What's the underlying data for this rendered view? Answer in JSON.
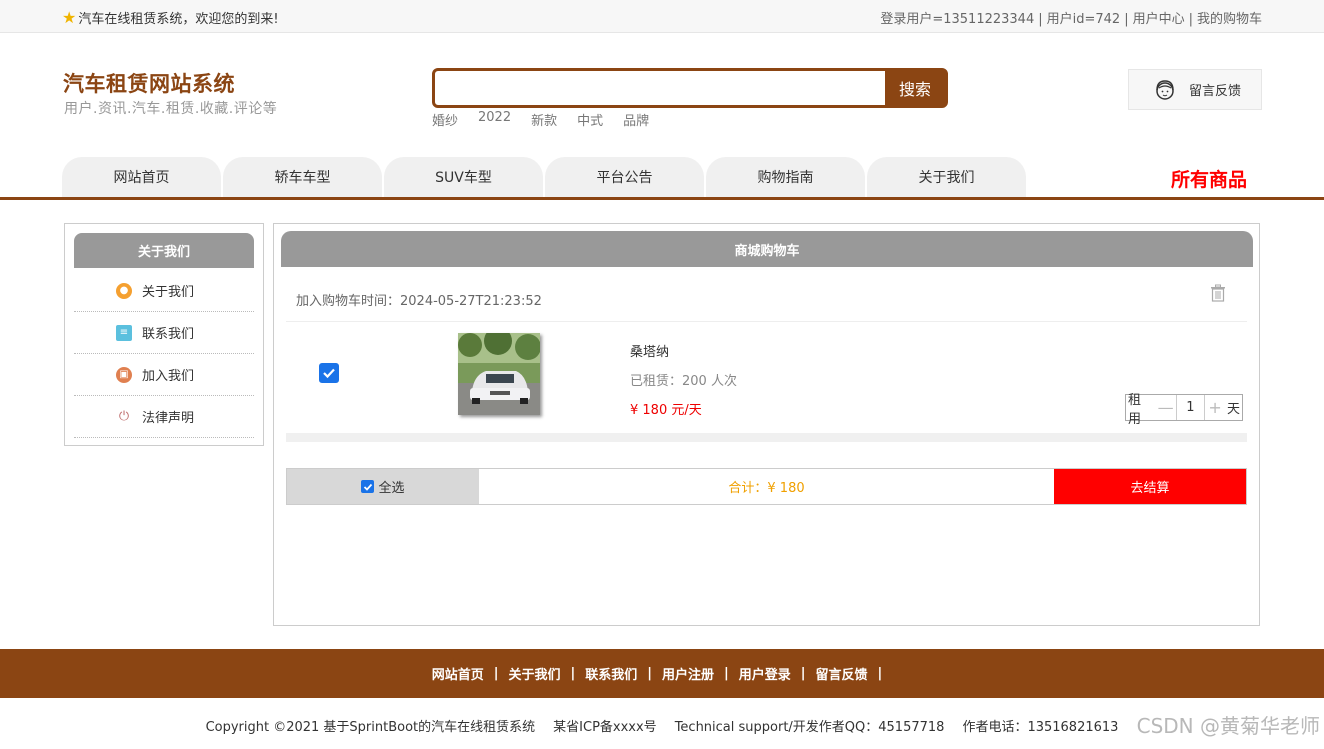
{
  "topbar": {
    "welcome": "汽车在线租赁系统，欢迎您的到来!",
    "user_login": "登录用户=13511223344",
    "user_id": "用户id=742",
    "user_center": "用户中心",
    "my_cart": "我的购物车"
  },
  "header": {
    "title": "汽车租赁网站系统",
    "subtitle": "用户.资讯.汽车.租赁.收藏.评论等",
    "search_placeholder": "",
    "search_button": "搜索",
    "hotwords": [
      "婚纱",
      "2022",
      "新款",
      "中式",
      "品牌"
    ],
    "feedback": "留言反馈"
  },
  "nav": {
    "tabs": [
      "网站首页",
      "轿车车型",
      "SUV车型",
      "平台公告",
      "购物指南",
      "关于我们"
    ],
    "all_goods": "所有商品"
  },
  "sidebar": {
    "title": "关于我们",
    "items": [
      {
        "label": "关于我们",
        "icon": "orange-circle-icon",
        "color": "#f5a030"
      },
      {
        "label": "联系我们",
        "icon": "clipboard-icon",
        "color": "#5bc0de"
      },
      {
        "label": "加入我们",
        "icon": "lock-icon",
        "color": "#e08050"
      },
      {
        "label": "法律声明",
        "icon": "power-icon",
        "color": "#c07070"
      }
    ]
  },
  "cart": {
    "title": "商城购物车",
    "added_time": "加入购物车时间：2024-05-27T21:23:52",
    "item": {
      "name": "桑塔纳",
      "rented": "已租赁：200 人次",
      "price": "¥ 180 元/天",
      "rent_label": "租用",
      "quantity": "1",
      "unit": "天",
      "checked": true
    },
    "select_all": "全选",
    "total": "合计：¥ 180",
    "checkout": "去结算"
  },
  "footer": {
    "links": [
      "网站首页",
      "关于我们",
      "联系我们",
      "用户注册",
      "用户登录",
      "留言反馈"
    ],
    "copyright": "Copyright ©2021 基于SprintBoot的汽车在线租赁系统",
    "icp": "某省ICP备xxxx号",
    "support": "Technical support/开发作者QQ：45157718",
    "phone": "作者电话：13516821613",
    "watermark": "CSDN @黄菊华老师"
  },
  "colors": {
    "brand": "#8b4513",
    "accent_red": "#ff0000",
    "total_orange": "#f0a000",
    "checkbox_blue": "#1a73e8"
  }
}
